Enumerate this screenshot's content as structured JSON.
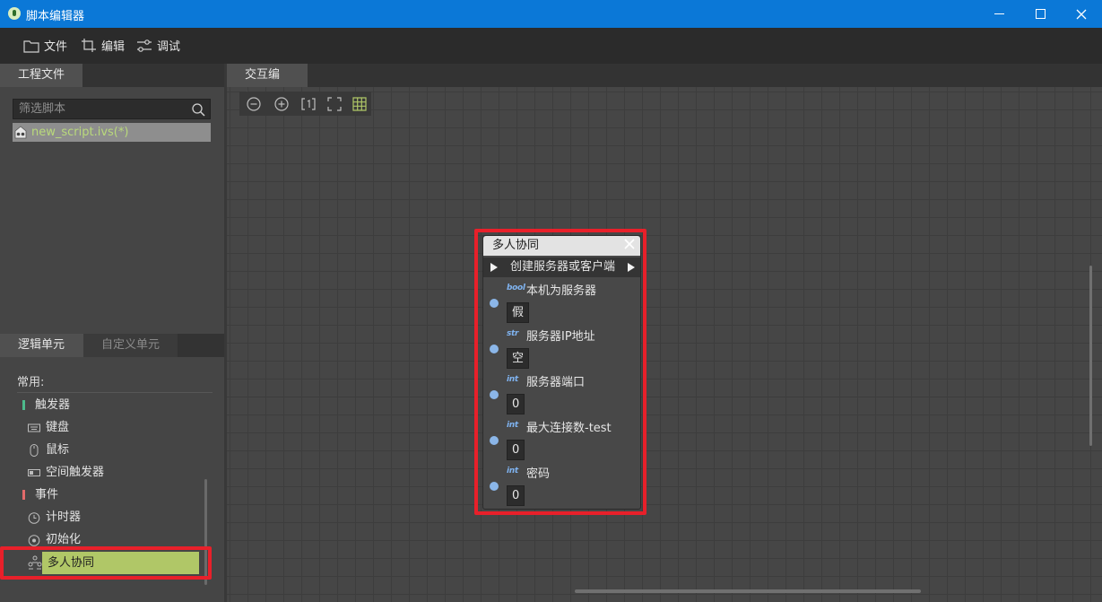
{
  "window": {
    "title": "脚本编辑器"
  },
  "menu": {
    "file": "文件",
    "edit": "编辑",
    "debug": "调试"
  },
  "project_panel": {
    "tab": "工程文件",
    "filter_placeholder": "筛选脚本",
    "script_item": "new_script.ivs(*)"
  },
  "library_panel": {
    "tabs": [
      "逻辑单元",
      "自定义单元"
    ],
    "section_title": "常用:",
    "items": [
      {
        "label": "触发器",
        "icon": "category-marker",
        "color": "#4dbb8c"
      },
      {
        "label": "键盘",
        "icon": "keyboard-icon"
      },
      {
        "label": "鼠标",
        "icon": "mouse-icon"
      },
      {
        "label": "空间触发器",
        "icon": "area-trigger-icon"
      },
      {
        "label": "事件",
        "icon": "category-marker",
        "color": "#e26a6a"
      },
      {
        "label": "计时器",
        "icon": "timer-icon"
      },
      {
        "label": "初始化",
        "icon": "init-icon"
      },
      {
        "label": "多人协同",
        "icon": "multiplayer-icon"
      }
    ],
    "selected_item": "多人协同"
  },
  "editor": {
    "tab": "交互编辑",
    "toolbar": [
      "zoom-out-icon",
      "zoom-in-icon",
      "actual-size-icon",
      "fit-screen-icon",
      "grid-toggle-icon"
    ]
  },
  "node": {
    "title": "多人协同",
    "exec_label": "创建服务器或客户端",
    "params": [
      {
        "type": "bool",
        "name": "本机为服务器",
        "value": "假"
      },
      {
        "type": "str",
        "name": "服务器IP地址",
        "value": "空"
      },
      {
        "type": "int",
        "name": "服务器端口",
        "value": "0"
      },
      {
        "type": "int",
        "name": "最大连接数-test",
        "value": "0"
      },
      {
        "type": "int",
        "name": "密码",
        "value": "0"
      }
    ]
  },
  "colors": {
    "title_bar": "#0b78d7",
    "highlight": "#e8202a",
    "selection": "#b0c767",
    "script_text": "#b9d97b"
  }
}
